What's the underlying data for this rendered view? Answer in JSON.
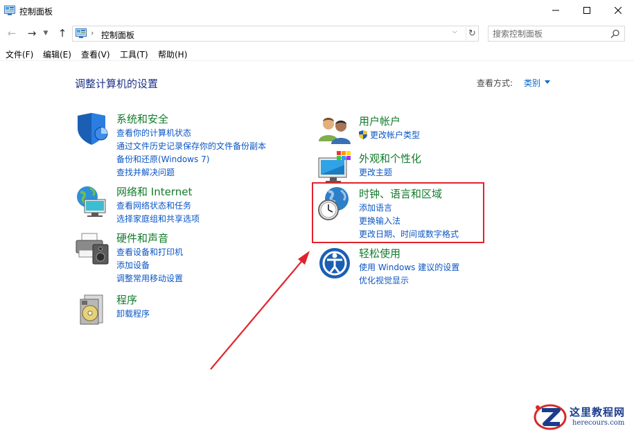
{
  "window": {
    "title": "控制面板",
    "controls": {
      "minimize": "—",
      "maximize": "☐",
      "close": "✕"
    }
  },
  "address": {
    "breadcrumb": "控制面板",
    "search_placeholder": "搜索控制面板"
  },
  "menu": [
    "文件(F)",
    "编辑(E)",
    "查看(V)",
    "工具(T)",
    "帮助(H)"
  ],
  "content": {
    "heading": "调整计算机的设置",
    "view_by_label": "查看方式:",
    "view_by_value": "类别"
  },
  "categories": [
    {
      "title": "系统和安全",
      "icon": "shield-icon",
      "links": [
        "查看你的计算机状态",
        "通过文件历史记录保存你的文件备份副本",
        "备份和还原(Windows 7)",
        "查找并解决问题"
      ]
    },
    {
      "title": "网络和 Internet",
      "icon": "network-globe-icon",
      "links": [
        "查看网络状态和任务",
        "选择家庭组和共享选项"
      ]
    },
    {
      "title": "硬件和声音",
      "icon": "printer-speaker-icon",
      "links": [
        "查看设备和打印机",
        "添加设备",
        "调整常用移动设置"
      ]
    },
    {
      "title": "程序",
      "icon": "programs-disc-icon",
      "links": [
        "卸载程序"
      ]
    },
    {
      "title": "用户帐户",
      "icon": "users-icon",
      "links": [
        "更改帐户类型"
      ]
    },
    {
      "title": "外观和个性化",
      "icon": "display-palette-icon",
      "links": [
        "更改主题"
      ]
    },
    {
      "title": "时钟、语言和区域",
      "icon": "clock-globe-icon",
      "links": [
        "添加语言",
        "更换输入法",
        "更改日期、时间或数字格式"
      ]
    },
    {
      "title": "轻松使用",
      "icon": "ease-of-access-icon",
      "links": [
        "使用 Windows 建议的设置",
        "优化视觉显示"
      ]
    }
  ],
  "annotation": {
    "color": "#e0232a"
  },
  "watermark": {
    "title": "这里教程网",
    "url": "herecours.com"
  },
  "colors": {
    "category_title": "#117a2a",
    "link": "#0b56c4",
    "heading": "#1e3287"
  }
}
